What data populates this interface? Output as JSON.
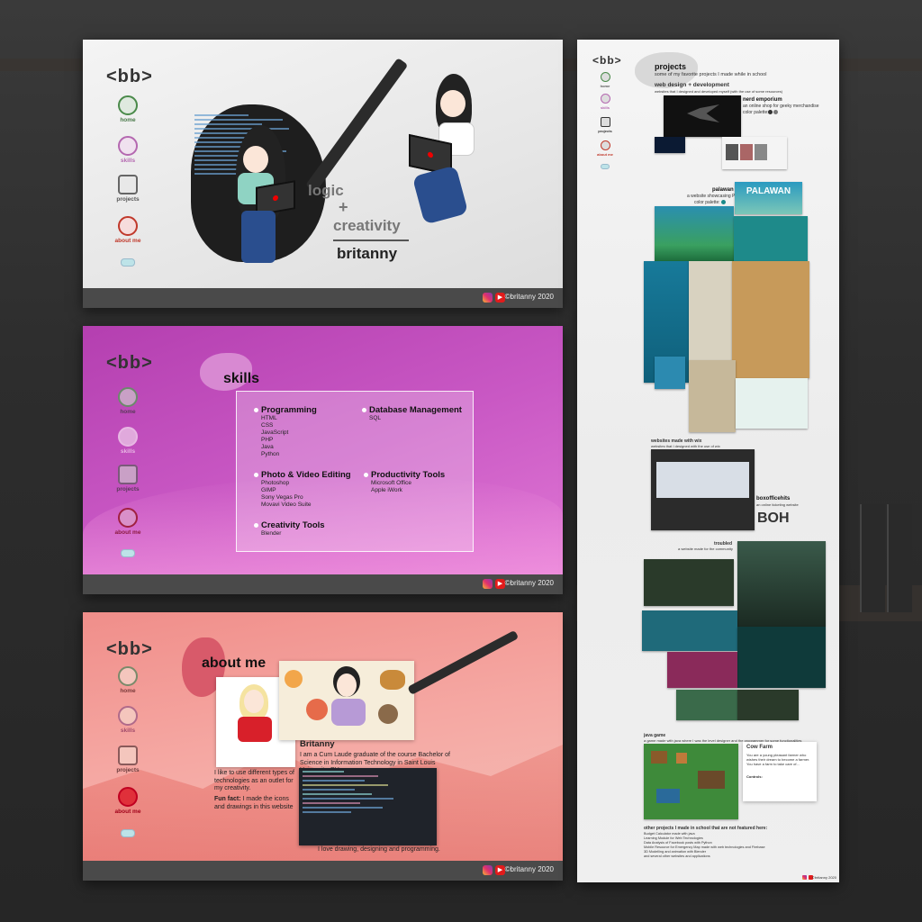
{
  "logo": "<bb>",
  "nav": {
    "home": "home",
    "skills": "skills",
    "projects": "projects",
    "about": "about me"
  },
  "footer": {
    "copyright": "©britanny 2020",
    "youtube_glyph": "▶"
  },
  "hero": {
    "line1": "logic",
    "plus": "+",
    "line2": "creativity",
    "name": "britanny"
  },
  "skills": {
    "title": "skills",
    "categories": [
      {
        "name": "Programming",
        "items": [
          "HTML",
          "CSS",
          "JavaScript",
          "PHP",
          "Java",
          "Python"
        ]
      },
      {
        "name": "Database Management",
        "items": [
          "SQL"
        ]
      },
      {
        "name": "Photo & Video Editing",
        "items": [
          "Photoshop",
          "GIMP",
          "Sony Vegas Pro",
          "Movavi Video Suite"
        ]
      },
      {
        "name": "Productivity Tools",
        "items": [
          "Microsoft Office",
          "Apple iWork"
        ]
      },
      {
        "name": "Creativity Tools",
        "items": [
          "Blender"
        ]
      }
    ]
  },
  "about": {
    "title": "about me",
    "name": "Britanny",
    "bio": "I am a Cum Laude graduate of the course Bachelor of Science in Information Technology in Saint Louis University, PH",
    "text1": "I like to use different types of technologies as an outlet for my creativity.",
    "funfact_label": "Fun fact:",
    "funfact": "I made the icons and drawings in this website",
    "closing": "I love drawing, designing and programming."
  },
  "projects": {
    "title": "projects",
    "subtitle": "some of my favorite projects I made while in school",
    "web_heading": "web design + development",
    "web_note": "websites that I designed and developed myself (with the use of some resources)",
    "nerd_title": "nerd emporium",
    "nerd_desc": "an online shop for geeky merchandise",
    "color_palette": "color palette:",
    "palawan_title": "palawan",
    "palawan_desc": "a website showcasing Palawan",
    "palawan_banner": "PALAWAN",
    "wix_title": "websites made with wix",
    "wix_desc": "websites that I designed with the use of wix",
    "boh_title": "boxofficehits",
    "boh_desc": "an online ticketing website",
    "boh_logo": "BOH",
    "troubled_title": "troubled",
    "troubled_desc": "a website made for the community",
    "java_title": "java game",
    "java_desc": "a game made with java where I was the level designer and the programmer for some functionalities",
    "cowfarm_title": "Cow Farm",
    "cowfarm_desc": "You are a young pleasant farmer who wishes their dream to become a farmer. You have a farm to take care of...",
    "controls_label": "Controls:",
    "other_heading": "other projects I made in school that are not featured here:",
    "other_items": [
      "Budget Calculator made with java",
      "Learning Module for Web Technologies",
      "Data Analysis of Facebook posts with Python",
      "Mobile Resource for Emergency Map made with web technologies and Firebase",
      "3D Modelling and animation with Blender",
      "and several other websites and applications"
    ]
  }
}
